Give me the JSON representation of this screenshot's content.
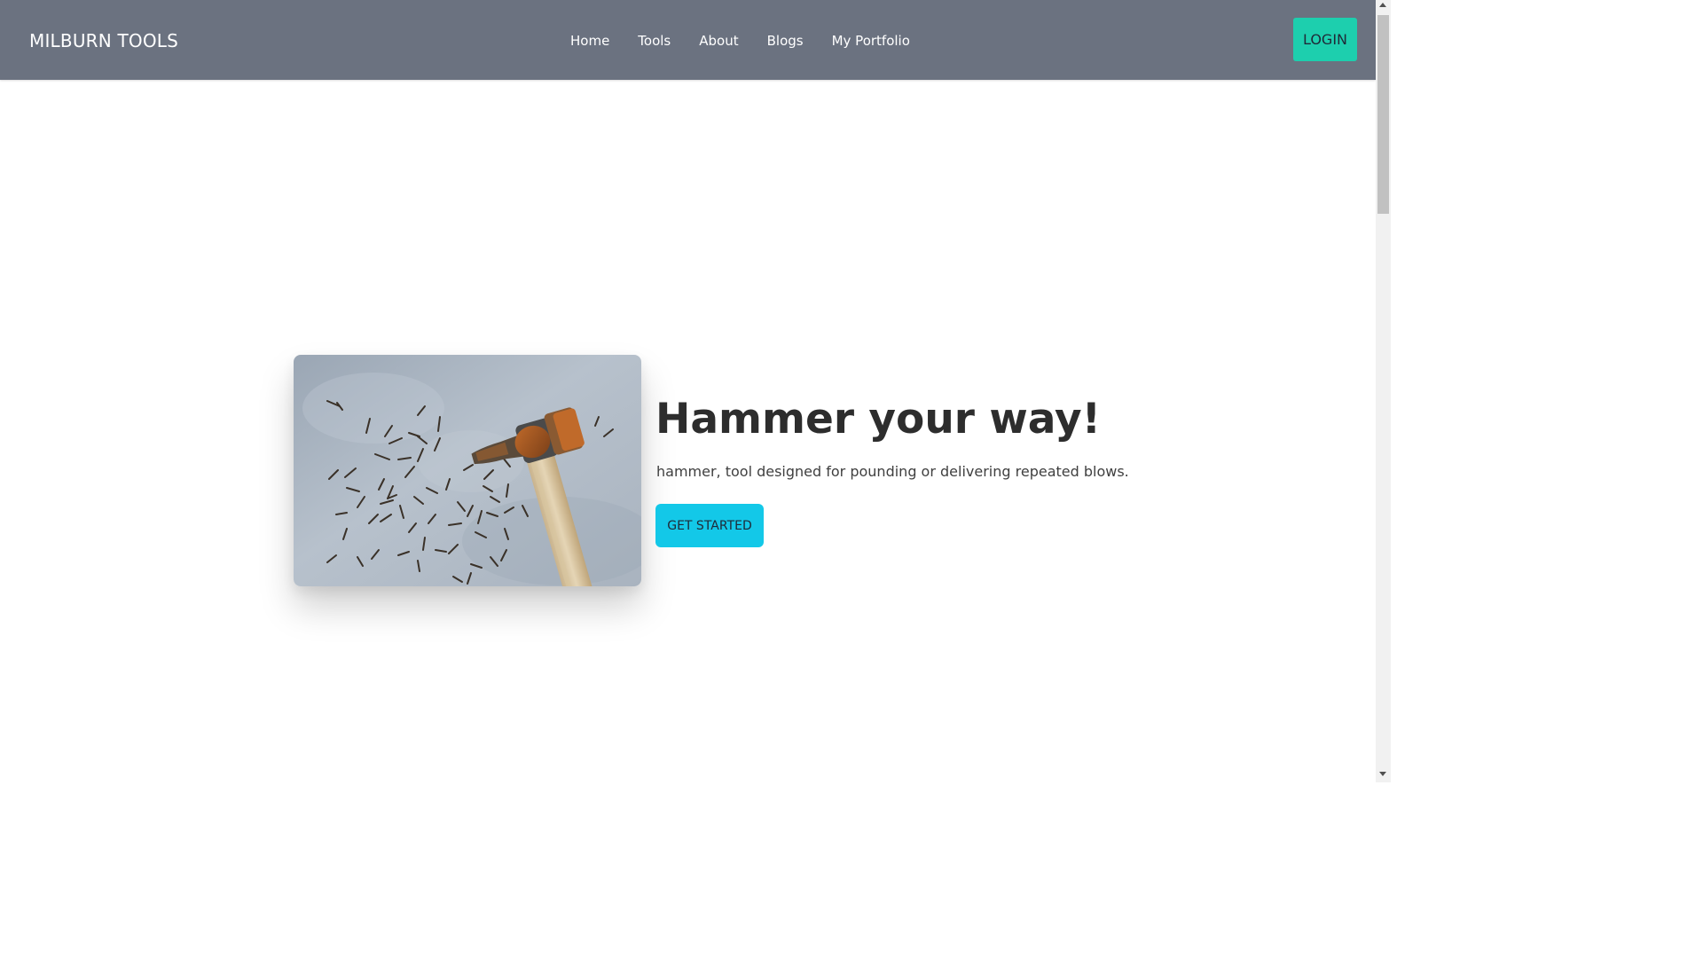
{
  "navbar": {
    "brand": "MILBURN TOOLS",
    "links": [
      {
        "label": "Home"
      },
      {
        "label": "Tools"
      },
      {
        "label": "About"
      },
      {
        "label": "Blogs"
      },
      {
        "label": "My Portfolio"
      }
    ],
    "login_label": "LOGIN",
    "background_color": "#6b7280",
    "login_color": "#1dcfae"
  },
  "hero": {
    "title": "Hammer your way!",
    "description": "hammer, tool designed for pounding or delivering repeated blows.",
    "cta_label": "GET STARTED",
    "cta_color": "#13c8e8"
  }
}
